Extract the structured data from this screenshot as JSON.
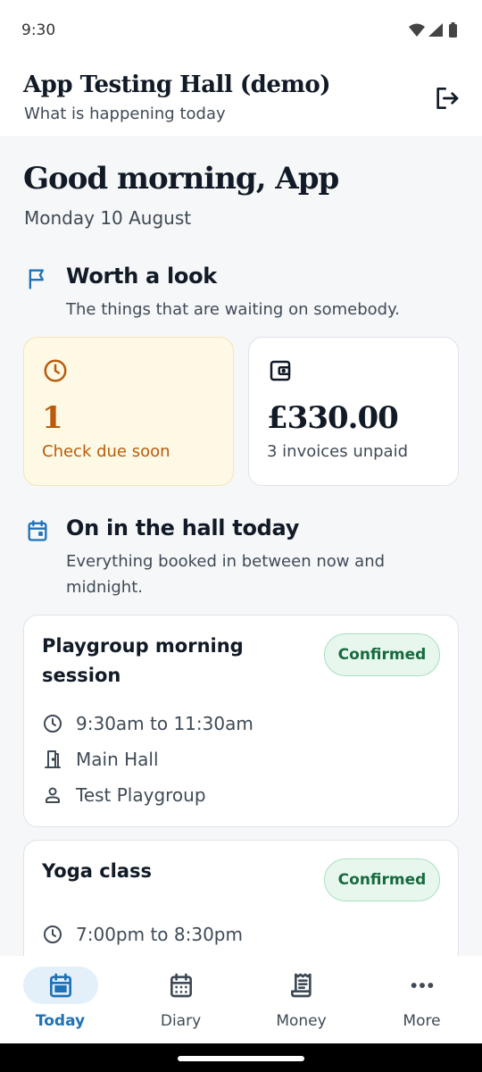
{
  "status_bar": {
    "time": "9:30"
  },
  "app_bar": {
    "title": "App Testing Hall (demo)",
    "subtitle": "What is happening today",
    "logout_icon": "logout-icon"
  },
  "greeting": {
    "headline": "Good morning, App",
    "date": "Monday 10 August"
  },
  "worth_a_look": {
    "icon": "flag-icon",
    "title": "Worth a look",
    "subtitle": "The things that are waiting on somebody.",
    "cards": [
      {
        "icon": "clock-icon",
        "value": "1",
        "label": "Check due soon",
        "tone": "warning"
      },
      {
        "icon": "wallet-icon",
        "value": "£330.00",
        "label": "3 invoices unpaid",
        "tone": "neutral"
      }
    ]
  },
  "on_today": {
    "icon": "calendar-icon",
    "title": "On in the hall today",
    "subtitle": "Everything booked in between now and midnight.",
    "bookings": [
      {
        "title": "Playgroup morning session",
        "status": "Confirmed",
        "time": "9:30am to 11:30am",
        "room": "Main Hall",
        "hirer": "Test Playgroup"
      },
      {
        "title": "Yoga class",
        "status": "Confirmed",
        "time": "7:00pm to 8:30pm"
      }
    ]
  },
  "bottom_nav": {
    "items": [
      {
        "label": "Today",
        "icon": "today-calendar-icon",
        "active": true
      },
      {
        "label": "Diary",
        "icon": "diary-calendar-icon",
        "active": false
      },
      {
        "label": "Money",
        "icon": "receipt-icon",
        "active": false
      },
      {
        "label": "More",
        "icon": "more-dots-icon",
        "active": false
      }
    ]
  },
  "colors": {
    "primary": "#1d72b8",
    "warning_text": "#b85c0c",
    "warning_bg": "#fef9e4",
    "success_text": "#176b3e",
    "success_bg": "#e8f7ee"
  }
}
